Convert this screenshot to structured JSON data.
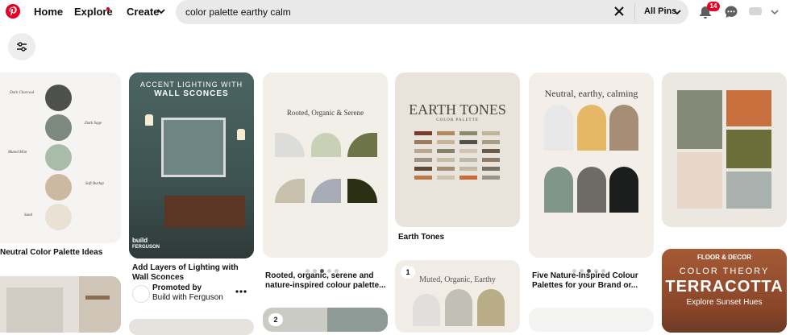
{
  "header": {
    "nav": {
      "home": "Home",
      "explore": "Explore",
      "create": "Create"
    },
    "search": {
      "value": "color palette earthy calm"
    },
    "all_pins": "All Pins",
    "notification_count": "14"
  },
  "pins": {
    "p1": {
      "caption": "Neutral Color Palette Ideas",
      "labels": [
        "Dark Charcoal",
        "Dark Sage",
        "Muted Mint",
        "Soft Burlap",
        "Sand"
      ],
      "colors": [
        "#4e504d",
        "#7d897e",
        "#a9bcaa",
        "#cdb9a1",
        "#e9e1d3"
      ]
    },
    "p2": {
      "title_line1": "ACCENT LIGHTING WITH",
      "title_line2": "WALL SCONCES",
      "caption": "Add Layers of Lighting with Wall Sconces",
      "promoted": "Promoted by",
      "promoter": "Build with Ferguson",
      "logo_text": "build",
      "logo_sub": "FERGUSON"
    },
    "p3": {
      "heading": "Rooted, Organic & Serene",
      "caption": "Rooted, organic, serene and nature-inspired colour palette...",
      "colors": [
        "#dcdcdb",
        "#c8d1b6",
        "#6c7448",
        "#c6c0ac",
        "#a7acb6",
        "#2b3014"
      ]
    },
    "p4": {
      "heading": "EARTH TONES",
      "sub": "COLOR PALETTE",
      "caption": "Earth Tones"
    },
    "p5": {
      "heading": "Neutral, earthy, calming",
      "caption": "Five Nature-Inspired Colour Palettes for your Brand or...",
      "colors": [
        "#e8e8e8",
        "#e6b865",
        "#a68e76",
        "#7f9688",
        "#6e6b67",
        "#1c1d1d"
      ]
    },
    "p6": {
      "colors": [
        "#848a78",
        "#c86f3e",
        "#e8d6c8",
        "#6b6e39",
        "#a9b1af"
      ]
    },
    "p7": {
      "count": "1",
      "heading": "Muted, Organic, Earthy"
    },
    "p8": {
      "count": "2"
    },
    "p9": {
      "brand": "FLOOR & DECOR",
      "line1": "COLOR THEORY",
      "line2": "TERRACOTTA",
      "line3": "Explore Sunset Hues"
    }
  }
}
